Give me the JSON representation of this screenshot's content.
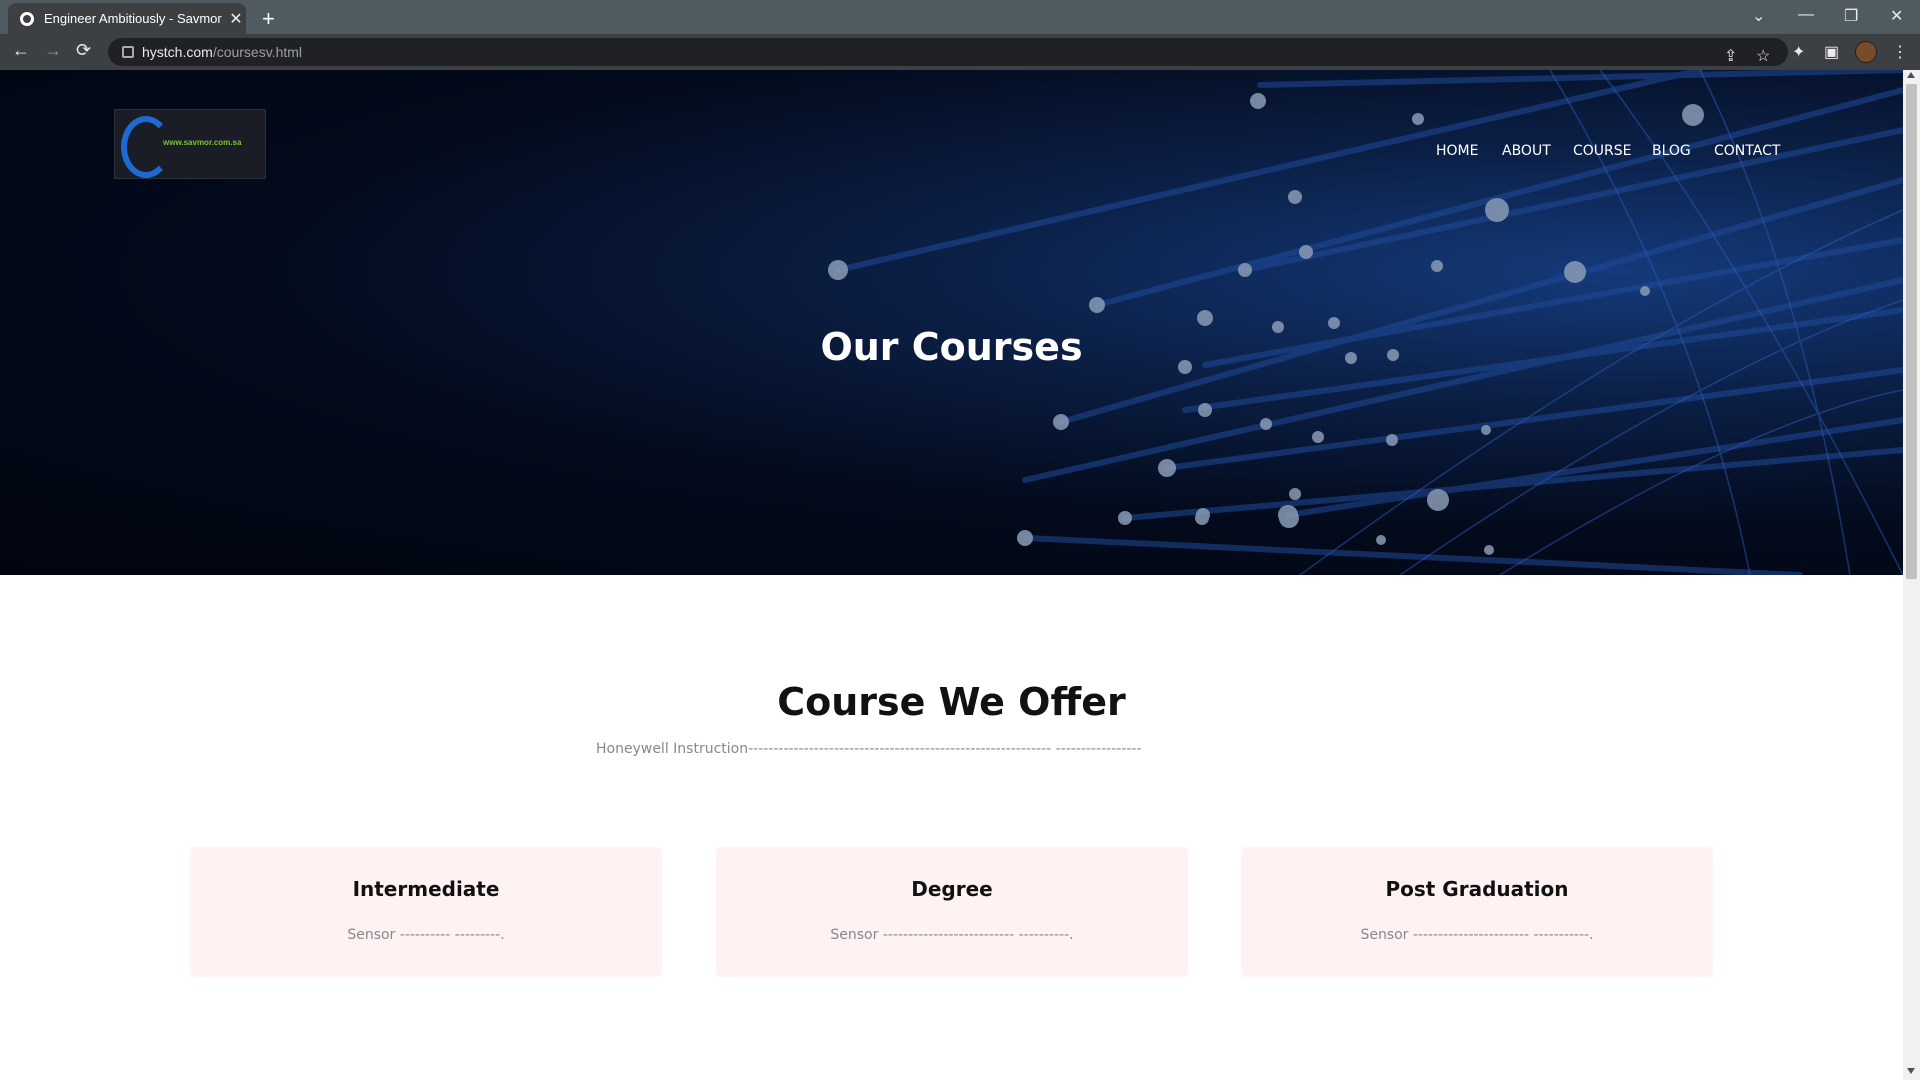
{
  "browser": {
    "tab_title": "Engineer Ambitiously - Savmor",
    "tab_close": "✕",
    "new_tab": "+",
    "url_host": "hystch.com",
    "url_path": "/coursesv.html",
    "window_controls": [
      "⌄",
      "—",
      "❐",
      "✕"
    ]
  },
  "header": {
    "logo_text": "www.savmor.com.sa",
    "nav": [
      "HOME",
      "ABOUT",
      "COURSE",
      "BLOG",
      "CONTACT"
    ]
  },
  "hero": {
    "title": "Our Courses"
  },
  "offer": {
    "title": "Course We Offer",
    "subtitle": "Honeywell Instruction------------------------------------------------------------ -----------------",
    "cards": [
      {
        "title": "Intermediate",
        "desc": "Sensor ---------- ---------."
      },
      {
        "title": "Degree",
        "desc": "Sensor -------------------------- ----------."
      },
      {
        "title": "Post Graduation",
        "desc": "Sensor ----------------------- -----------."
      }
    ]
  }
}
